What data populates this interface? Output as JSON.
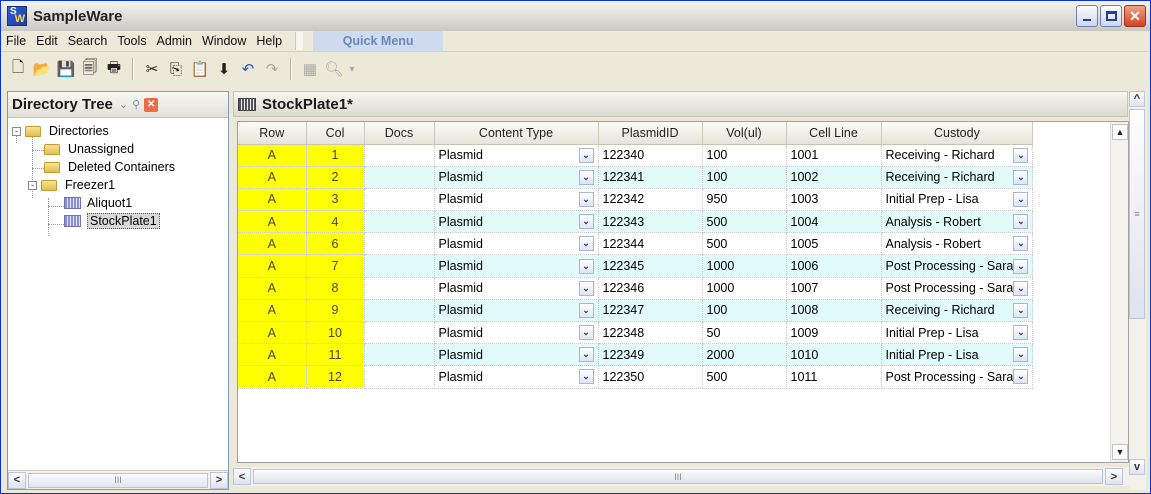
{
  "window": {
    "title": "SampleWare",
    "app_icon_text": "S",
    "app_icon_sub": "W"
  },
  "menu": [
    "File",
    "Edit",
    "Search",
    "Tools",
    "Admin",
    "Window",
    "Help"
  ],
  "quick_menu": "Quick Menu",
  "toolbar": [
    "new-icon",
    "open-folder-icon",
    "save-icon",
    "save-all-icon",
    "print-icon",
    "cut-icon",
    "copy-icon",
    "paste-icon",
    "move-down-icon",
    "undo-icon",
    "redo-icon",
    "plate-grid-icon",
    "search-dropdown-icon"
  ],
  "left_pane": {
    "title": "Directory Tree",
    "tree": [
      "Directories",
      "Unassigned",
      "Deleted Containers",
      "Freezer1",
      "Aliquot1",
      "StockPlate1"
    ]
  },
  "document": {
    "title": "StockPlate1*"
  },
  "grid": {
    "columns": [
      "Row",
      "Col",
      "Docs",
      "Content Type",
      "PlasmidID",
      "Vol(ul)",
      "Cell Line",
      "Custody"
    ],
    "rows": [
      [
        "A",
        "1",
        "",
        "Plasmid",
        "122340",
        "100",
        "1001",
        "Receiving - Richard"
      ],
      [
        "A",
        "2",
        "",
        "Plasmid",
        "122341",
        "100",
        "1002",
        "Receiving - Richard"
      ],
      [
        "A",
        "3",
        "",
        "Plasmid",
        "122342",
        "950",
        "1003",
        "Initial Prep - Lisa"
      ],
      [
        "A",
        "4",
        "",
        "Plasmid",
        "122343",
        "500",
        "1004",
        "Analysis - Robert"
      ],
      [
        "A",
        "6",
        "",
        "Plasmid",
        "122344",
        "500",
        "1005",
        "Analysis - Robert"
      ],
      [
        "A",
        "7",
        "",
        "Plasmid",
        "122345",
        "1000",
        "1006",
        "Post Processing - Sara"
      ],
      [
        "A",
        "8",
        "",
        "Plasmid",
        "122346",
        "1000",
        "1007",
        "Post Processing - Sara"
      ],
      [
        "A",
        "9",
        "",
        "Plasmid",
        "122347",
        "100",
        "1008",
        "Receiving - Richard"
      ],
      [
        "A",
        "10",
        "",
        "Plasmid",
        "122348",
        "50",
        "1009",
        "Initial Prep - Lisa"
      ],
      [
        "A",
        "11",
        "",
        "Plasmid",
        "122349",
        "2000",
        "1010",
        "Initial Prep - Lisa"
      ],
      [
        "A",
        "12",
        "",
        "Plasmid",
        "122350",
        "500",
        "1011",
        "Post Processing - Sara"
      ]
    ]
  },
  "colors": {
    "highlight": "#ffff00",
    "alt_row": "#e1fafa",
    "title_close": "#d1431f"
  }
}
